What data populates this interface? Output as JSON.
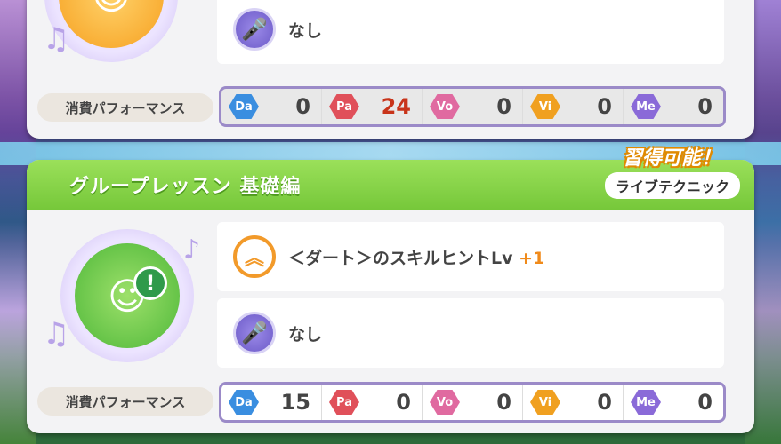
{
  "top_card": {
    "effect_none": "なし",
    "cost_label": "消費パフォーマンス",
    "stats": [
      {
        "key": "Da",
        "value": "0",
        "color": "#3a8ee0"
      },
      {
        "key": "Pa",
        "value": "24",
        "color": "#e0505a"
      },
      {
        "key": "Vo",
        "value": "0",
        "color": "#e06aa0"
      },
      {
        "key": "Vi",
        "value": "0",
        "color": "#f0a020"
      },
      {
        "key": "Me",
        "value": "0",
        "color": "#8a6ad8"
      }
    ]
  },
  "bottom_card": {
    "title": "グループレッスン 基礎編",
    "learnable_badge": "習得可能！",
    "tag": "ライブテクニック",
    "effect_hint_text": "＜ダート＞のスキルヒントLv",
    "effect_hint_plus": "+1",
    "effect_none": "なし",
    "cost_label": "消費パフォーマンス",
    "stats": [
      {
        "key": "Da",
        "value": "15",
        "color": "#3a8ee0"
      },
      {
        "key": "Pa",
        "value": "0",
        "color": "#e0505a"
      },
      {
        "key": "Vo",
        "value": "0",
        "color": "#e06aa0"
      },
      {
        "key": "Vi",
        "value": "0",
        "color": "#f0a020"
      },
      {
        "key": "Me",
        "value": "0",
        "color": "#8a6ad8"
      }
    ]
  },
  "icons": {
    "mic": "mic-icon",
    "up": "double-chevron-up-icon",
    "note": "music-note-icon",
    "exclamation": "exclamation-icon"
  }
}
